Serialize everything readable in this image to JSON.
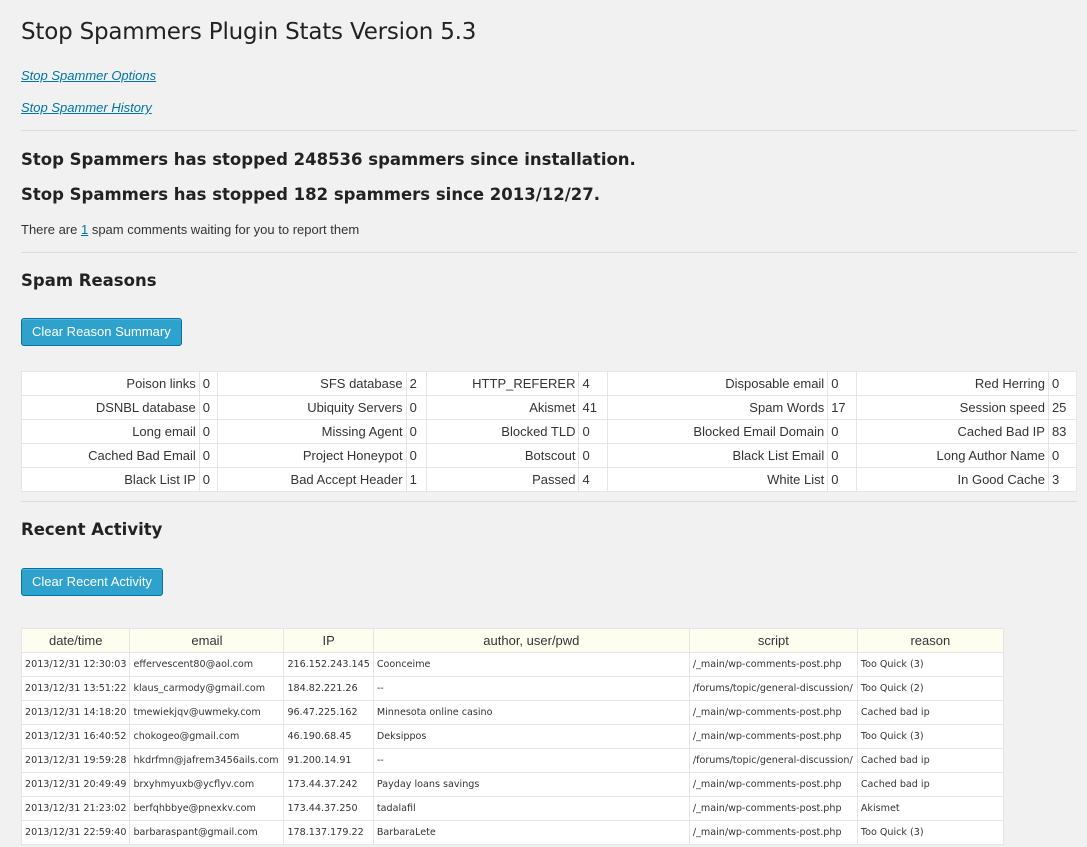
{
  "page_title": "Stop Spammers Plugin Stats Version 5.3",
  "links": {
    "options": "Stop Spammer Options",
    "history": "Stop Spammer History"
  },
  "stats": {
    "total_line": "Stop Spammers has stopped 248536 spammers since installation.",
    "since_line": "Stop Spammers has stopped 182 spammers since 2013/12/27.",
    "waiting_prefix": "There are ",
    "waiting_count": "1",
    "waiting_suffix": " spam comments waiting for you to report them"
  },
  "reasons_section": {
    "heading": "Spam Reasons",
    "clear_button": "Clear Reason Summary",
    "rows": [
      [
        [
          "Poison links",
          "0"
        ],
        [
          "SFS database",
          "2"
        ],
        [
          "HTTP_REFERER",
          "4"
        ],
        [
          "Disposable email",
          "0"
        ],
        [
          "Red Herring",
          "0"
        ]
      ],
      [
        [
          "DSNBL database",
          "0"
        ],
        [
          "Ubiquity Servers",
          "0"
        ],
        [
          "Akismet",
          "41"
        ],
        [
          "Spam Words",
          "17"
        ],
        [
          "Session speed",
          "25"
        ]
      ],
      [
        [
          "Long email",
          "0"
        ],
        [
          "Missing Agent",
          "0"
        ],
        [
          "Blocked TLD",
          "0"
        ],
        [
          "Blocked Email Domain",
          "0"
        ],
        [
          "Cached Bad IP",
          "83"
        ]
      ],
      [
        [
          "Cached Bad Email",
          "0"
        ],
        [
          "Project Honeypot",
          "0"
        ],
        [
          "Botscout",
          "0"
        ],
        [
          "Black List Email",
          "0"
        ],
        [
          "Long Author Name",
          "0"
        ]
      ],
      [
        [
          "Black List IP",
          "0"
        ],
        [
          "Bad Accept Header",
          "1"
        ],
        [
          "Passed",
          "4"
        ],
        [
          "White List",
          "0"
        ],
        [
          "In Good Cache",
          "3"
        ]
      ]
    ]
  },
  "activity_section": {
    "heading": "Recent Activity",
    "clear_button": "Clear Recent Activity",
    "columns": [
      "date/time",
      "email",
      "IP",
      "author, user/pwd",
      "script",
      "reason"
    ],
    "rows": [
      [
        "2013/12/31 12:30:03",
        "effervescent80@aol.com",
        "216.152.243.145",
        "Coonceime",
        "/_main/wp-comments-post.php",
        "Too Quick (3)"
      ],
      [
        "2013/12/31 13:51:22",
        "klaus_carmody@gmail.com",
        "184.82.221.26",
        "--",
        "/forums/topic/general-discussion/",
        "Too Quick (2)"
      ],
      [
        "2013/12/31 14:18:20",
        "tmewiekjqv@uwmeky.com",
        "96.47.225.162",
        "Minnesota online casino",
        "/_main/wp-comments-post.php",
        "Cached bad ip"
      ],
      [
        "2013/12/31 16:40:52",
        "chokogeo@gmail.com",
        "46.190.68.45",
        "Deksippos",
        "/_main/wp-comments-post.php",
        "Too Quick (3)"
      ],
      [
        "2013/12/31 19:59:28",
        "hkdrfmn@jafrem3456ails.com",
        "91.200.14.91",
        "--",
        "/forums/topic/general-discussion/",
        "Cached bad ip"
      ],
      [
        "2013/12/31 20:49:49",
        "brxyhmyuxb@ycflyv.com",
        "173.44.37.242",
        "Payday loans savings",
        "/_main/wp-comments-post.php",
        "Cached bad ip"
      ],
      [
        "2013/12/31 21:23:02",
        "berfqhbbye@pnexkv.com",
        "173.44.37.250",
        "tadalafil",
        "/_main/wp-comments-post.php",
        "Akismet"
      ],
      [
        "2013/12/31 22:59:40",
        "barbaraspant@gmail.com",
        "178.137.179.22",
        "BarbaraLete",
        "/_main/wp-comments-post.php",
        "Too Quick (3)"
      ]
    ]
  },
  "colors": {
    "link": "#0074a2",
    "button": "#2ea2cc",
    "header_bg": "#fefef0",
    "page_bg": "#f1f1f1"
  }
}
